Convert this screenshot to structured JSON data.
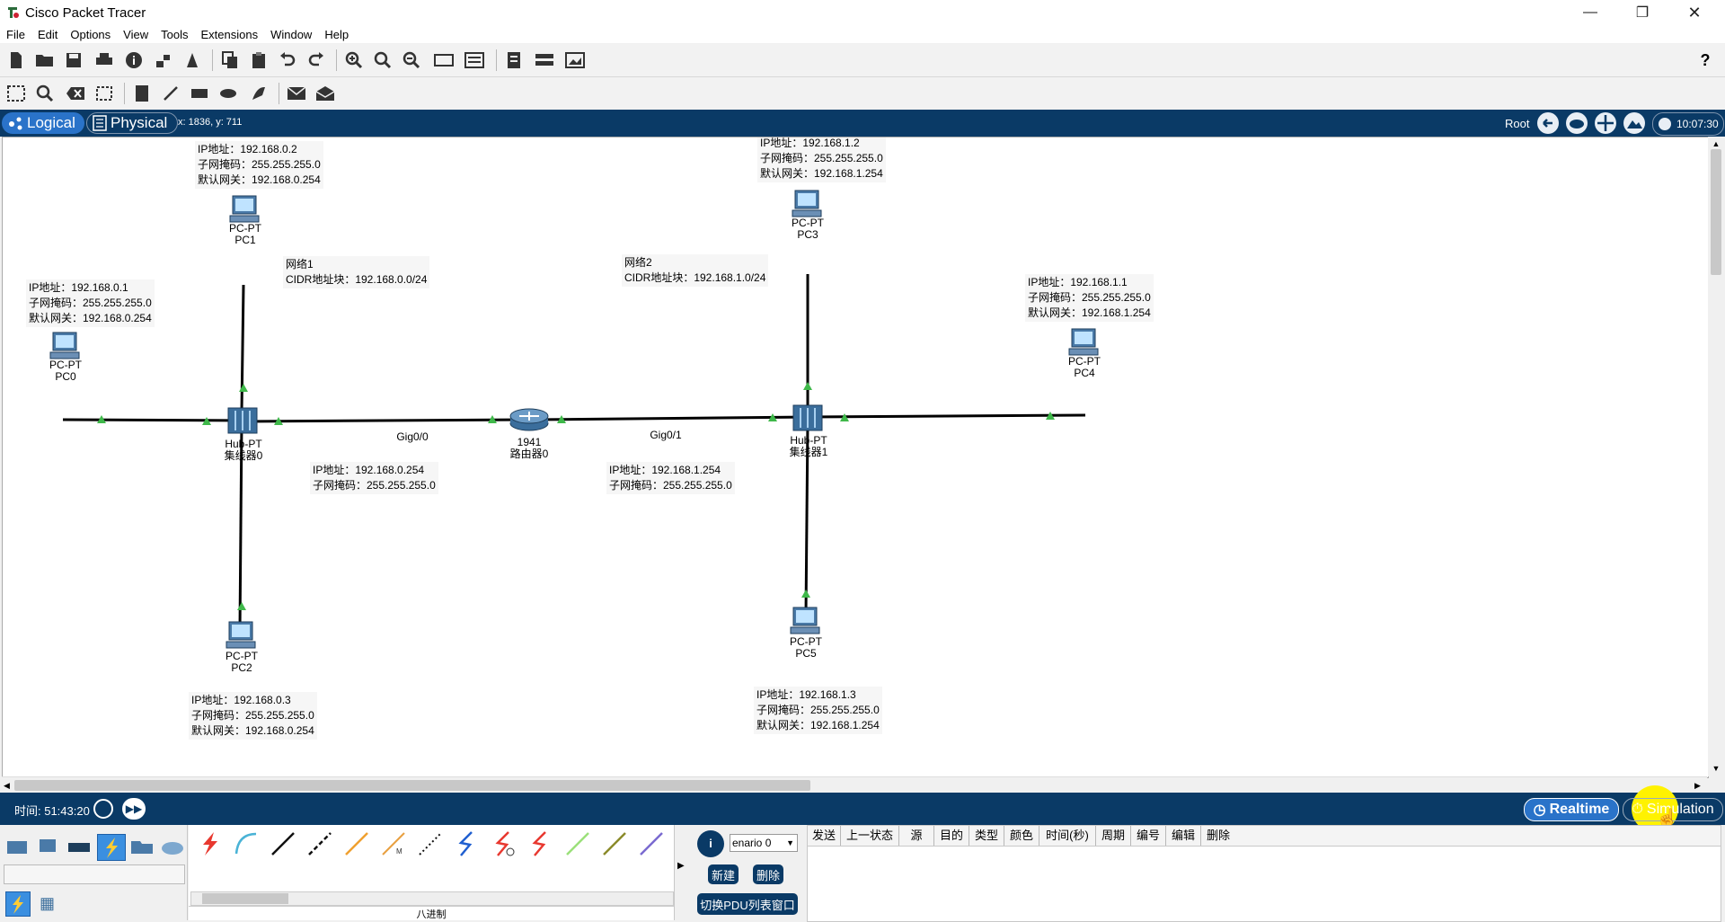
{
  "window": {
    "title": "Cisco Packet Tracer"
  },
  "menu": [
    "File",
    "Edit",
    "Options",
    "View",
    "Tools",
    "Extensions",
    "Window",
    "Help"
  ],
  "nav": {
    "logical": "Logical",
    "physical": "Physical",
    "coords": "x: 1836, y: 711",
    "root": "Root",
    "clock": "10:07:30"
  },
  "devices": [
    {
      "model": "PC-PT",
      "name": "PC0"
    },
    {
      "model": "PC-PT",
      "name": "PC1"
    },
    {
      "model": "PC-PT",
      "name": "PC2"
    },
    {
      "model": "PC-PT",
      "name": "PC3"
    },
    {
      "model": "PC-PT",
      "name": "PC4"
    },
    {
      "model": "PC-PT",
      "name": "PC5"
    },
    {
      "model": "Hub-PT",
      "name": "集线器0"
    },
    {
      "model": "Hub-PT",
      "name": "集线器1"
    },
    {
      "model": "1941",
      "name": "路由器0"
    }
  ],
  "ports": {
    "left": "Gig0/0",
    "right": "Gig0/1"
  },
  "notes": {
    "pc1": "IP地址：192.168.0.2\n子网掩码：255.255.255.0\n默认网关：192.168.0.254",
    "pc0": "IP地址：192.168.0.1\n子网掩码：255.255.255.0\n默认网关：192.168.0.254",
    "pc2": "IP地址：192.168.0.3\n子网掩码：255.255.255.0\n默认网关：192.168.0.254",
    "pc3": "IP地址：192.168.1.2\n子网掩码：255.255.255.0\n默认网关：192.168.1.254",
    "pc4": "IP地址：192.168.1.1\n子网掩码：255.255.255.0\n默认网关：192.168.1.254",
    "pc5": "IP地址：192.168.1.3\n子网掩码：255.255.255.0\n默认网关：192.168.1.254",
    "net1": "网络1\nCIDR地址块：192.168.0.0/24",
    "net2": "网络2\nCIDR地址块：192.168.1.0/24",
    "gw0": "IP地址：192.168.0.254\n子网掩码：255.255.255.0",
    "gw1": "IP地址：192.168.1.254\n子网掩码：255.255.255.0"
  },
  "sim": {
    "time": "时间: 51:43:20",
    "realtime": "Realtime",
    "simulation": "Simulation"
  },
  "pdu": {
    "scenario": "enario 0",
    "new_label": "新建",
    "delete_label": "删除",
    "toggle_label": "切换PDU列表窗口",
    "columns": [
      "发送",
      "上一状态",
      "源",
      "目的",
      "类型",
      "颜色",
      "时间(秒)",
      "周期",
      "编号",
      "编辑",
      "删除"
    ]
  },
  "connections_footer": "八进制",
  "colors": {
    "navy": "#0a3a66",
    "link_ok": "#3fb84a",
    "realtime_btn": "#2a73c9"
  }
}
